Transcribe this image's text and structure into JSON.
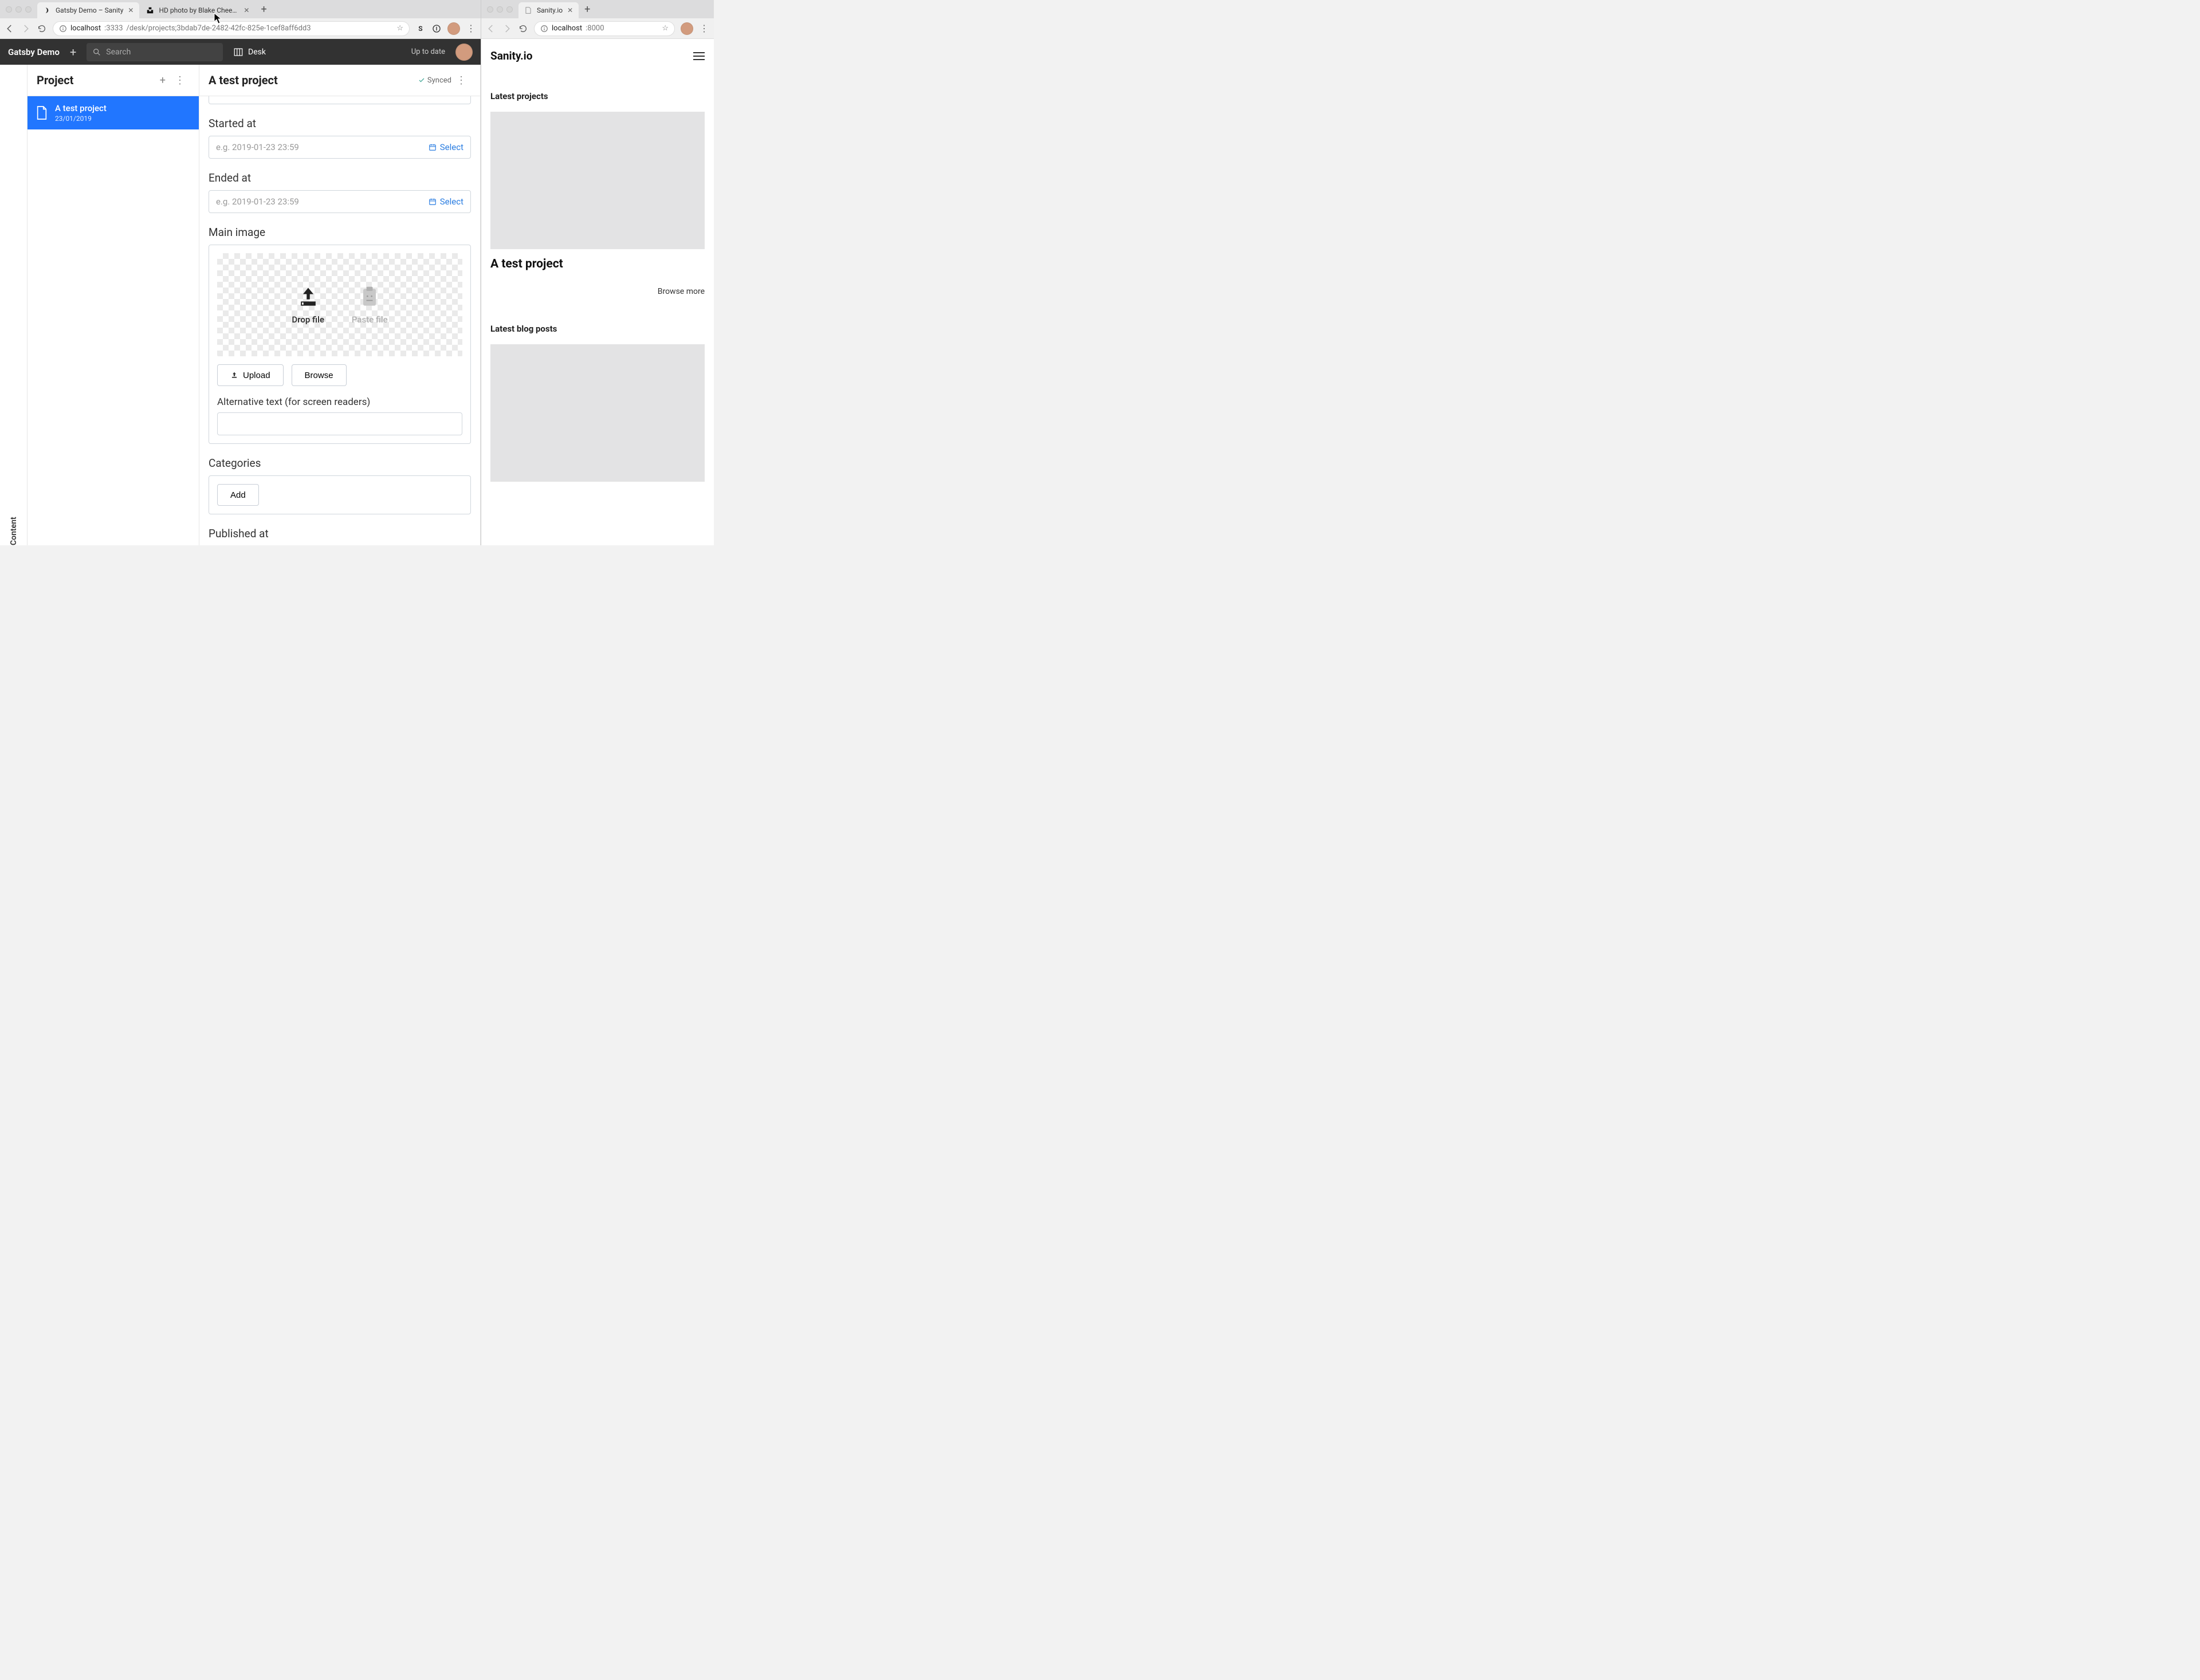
{
  "left_window": {
    "tabs": [
      {
        "title": "Gatsby Demo – Sanity"
      },
      {
        "title": "HD photo by Blake Cheek (@bl"
      }
    ],
    "url": {
      "host": "localhost",
      "port": ":3333",
      "path": "/desk/projects;3bdab7de-2482-42fc-825e-1cef8aff6dd3"
    },
    "studio": {
      "brand": "Gatsby Demo",
      "search_placeholder": "Search",
      "desk_label": "Desk",
      "status": "Up to date",
      "rail": "Content",
      "list_pane": {
        "title": "Project",
        "doc": {
          "title": "A test project",
          "date": "23/01/2019"
        }
      },
      "editor": {
        "title": "A test project",
        "synced": "Synced",
        "fields": {
          "started_at": {
            "label": "Started at",
            "placeholder": "e.g. 2019-01-23 23:59",
            "select": "Select"
          },
          "ended_at": {
            "label": "Ended at",
            "placeholder": "e.g. 2019-01-23 23:59",
            "select": "Select"
          },
          "main_image": {
            "label": "Main image",
            "drop": "Drop file",
            "paste": "Paste file",
            "upload": "Upload",
            "browse": "Browse",
            "alt_label": "Alternative text (for screen readers)"
          },
          "categories": {
            "label": "Categories",
            "add": "Add"
          },
          "published_at": {
            "label": "Published at"
          }
        }
      }
    }
  },
  "right_window": {
    "tab": {
      "title": "Sanity.io"
    },
    "url": {
      "host": "localhost",
      "port": ":8000"
    },
    "site": {
      "brand": "Sanity.io",
      "sections": {
        "projects": {
          "heading": "Latest projects",
          "card_title": "A test project",
          "browse": "Browse more"
        },
        "blog": {
          "heading": "Latest blog posts"
        }
      }
    }
  }
}
